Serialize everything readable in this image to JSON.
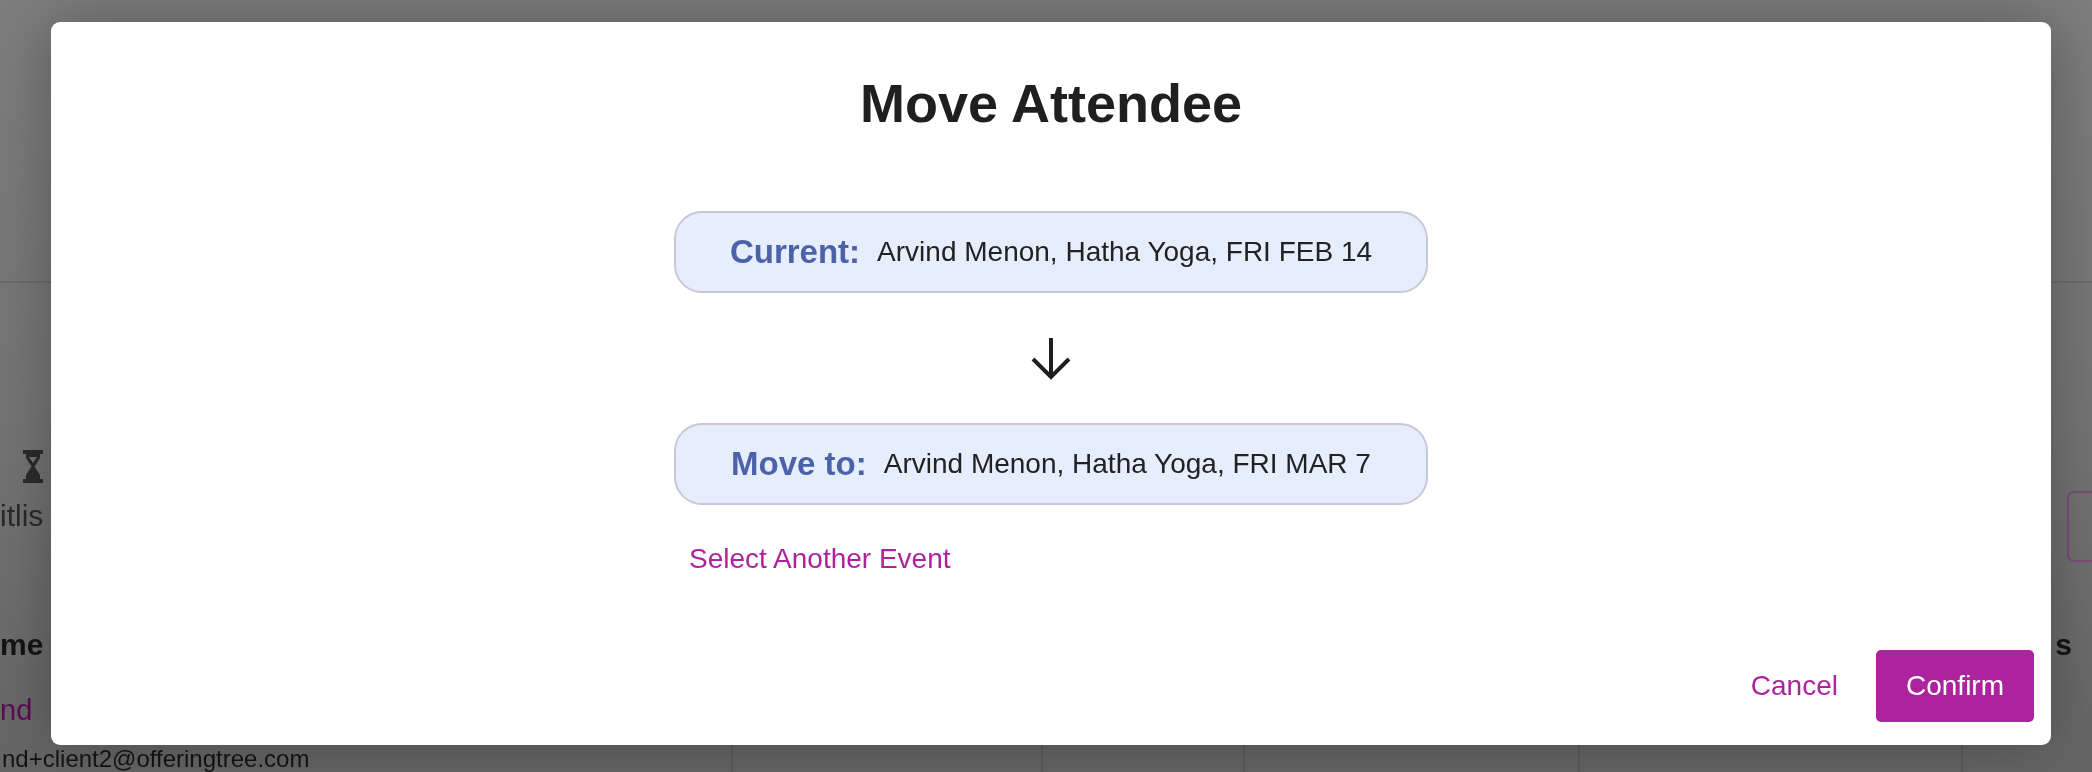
{
  "background": {
    "waitlist_tab": {
      "label": "itlis"
    },
    "table": {
      "columns": [
        {
          "label": "me"
        },
        {
          "label": "s"
        }
      ],
      "rows": [
        {
          "name": "nd",
          "email": "nd+client2@offeringtree.com"
        }
      ]
    }
  },
  "dialog": {
    "title": "Move Attendee",
    "events": [
      {
        "label": "Current:",
        "value": "Arvind Menon, Hatha Yoga, FRI FEB 14"
      },
      {
        "label": "Move to:",
        "value": "Arvind Menon, Hatha Yoga, FRI MAR 7"
      }
    ],
    "link": "Select Another Event",
    "buttons": [
      {
        "label": "Cancel",
        "kind": "text"
      },
      {
        "label": "Confirm",
        "kind": "primary"
      }
    ]
  }
}
